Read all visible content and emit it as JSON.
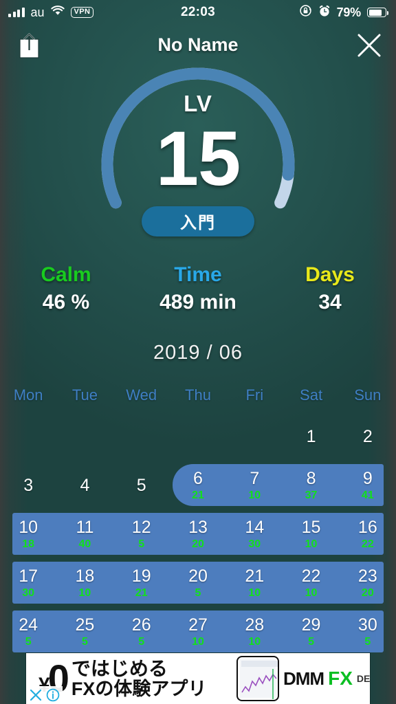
{
  "status_bar": {
    "carrier": "au",
    "vpn_badge": "VPN",
    "time": "22:03",
    "battery_percent": "79%",
    "icons": [
      "signal-bars-icon",
      "wifi-icon",
      "vpn-icon",
      "rotation-lock-icon",
      "alarm-clock-icon",
      "battery-icon"
    ],
    "signal_bars_filled": 4,
    "battery_level": 79
  },
  "nav": {
    "title": "No Name",
    "share_icon": "share-icon",
    "close_icon": "close-icon"
  },
  "gauge": {
    "label": "LV",
    "value": "15",
    "badge": "入門",
    "progress_percent": 92,
    "track_color": "#c3d6ea",
    "fill_color": "#4a84b5",
    "badge_color": "#1b6f9c"
  },
  "stats": [
    {
      "label": "Calm",
      "value": "46 %",
      "color": "#19cc1f"
    },
    {
      "label": "Time",
      "value": "489 min",
      "color": "#29a8e8"
    },
    {
      "label": "Days",
      "value": "34",
      "color": "#e8e81a"
    }
  ],
  "calendar": {
    "month_title": "2019 / 06",
    "dow_color": "#3f7fc4",
    "highlight_color": "#4d7dbe",
    "minutes_color": "#12e01b",
    "day_of_week": [
      "Mon",
      "Tue",
      "Wed",
      "Thu",
      "Fri",
      "Sat",
      "Sun"
    ],
    "weeks": [
      {
        "highlight": null,
        "days": [
          {
            "day": "",
            "minutes": ""
          },
          {
            "day": "",
            "minutes": ""
          },
          {
            "day": "",
            "minutes": ""
          },
          {
            "day": "",
            "minutes": ""
          },
          {
            "day": "",
            "minutes": ""
          },
          {
            "day": "1",
            "minutes": ""
          },
          {
            "day": "2",
            "minutes": ""
          }
        ]
      },
      {
        "highlight": {
          "start": 3,
          "end": 6,
          "round_left": true,
          "round_right": false
        },
        "days": [
          {
            "day": "3",
            "minutes": ""
          },
          {
            "day": "4",
            "minutes": ""
          },
          {
            "day": "5",
            "minutes": ""
          },
          {
            "day": "6",
            "minutes": "21"
          },
          {
            "day": "7",
            "minutes": "10"
          },
          {
            "day": "8",
            "minutes": "37"
          },
          {
            "day": "9",
            "minutes": "41"
          }
        ]
      },
      {
        "highlight": {
          "start": 0,
          "end": 6,
          "round_left": false,
          "round_right": false
        },
        "days": [
          {
            "day": "10",
            "minutes": "18"
          },
          {
            "day": "11",
            "minutes": "40"
          },
          {
            "day": "12",
            "minutes": "5"
          },
          {
            "day": "13",
            "minutes": "20"
          },
          {
            "day": "14",
            "minutes": "30"
          },
          {
            "day": "15",
            "minutes": "10"
          },
          {
            "day": "16",
            "minutes": "22"
          }
        ]
      },
      {
        "highlight": {
          "start": 0,
          "end": 6,
          "round_left": false,
          "round_right": false
        },
        "days": [
          {
            "day": "17",
            "minutes": "30"
          },
          {
            "day": "18",
            "minutes": "10"
          },
          {
            "day": "19",
            "minutes": "21"
          },
          {
            "day": "20",
            "minutes": "5"
          },
          {
            "day": "21",
            "minutes": "10"
          },
          {
            "day": "22",
            "minutes": "10"
          },
          {
            "day": "23",
            "minutes": "20"
          }
        ]
      },
      {
        "highlight": {
          "start": 0,
          "end": 6,
          "round_left": false,
          "round_right": false
        },
        "days": [
          {
            "day": "24",
            "minutes": "5"
          },
          {
            "day": "25",
            "minutes": "5"
          },
          {
            "day": "26",
            "minutes": "5"
          },
          {
            "day": "27",
            "minutes": "10"
          },
          {
            "day": "28",
            "minutes": "10"
          },
          {
            "day": "29",
            "minutes": "5"
          },
          {
            "day": "30",
            "minutes": "5"
          }
        ]
      }
    ]
  },
  "ad": {
    "yen_symbol": "¥",
    "yen_amount": "0",
    "headline_1": "ではじめる",
    "headline_2": "FXの体験アプリ",
    "brand": "DMM",
    "brand_fx": "FX",
    "brand_suffix": "DEMO",
    "close_icon": "ad-close-icon",
    "info_icon": "ad-info-icon"
  }
}
